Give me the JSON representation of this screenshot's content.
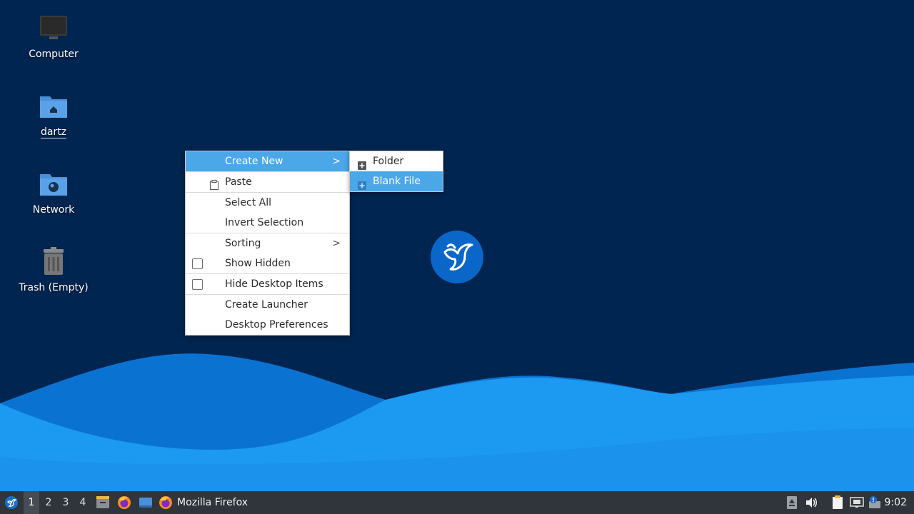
{
  "desktop": {
    "icons": [
      {
        "label": "Computer"
      },
      {
        "label": "dartz"
      },
      {
        "label": "Network"
      },
      {
        "label": "Trash (Empty)"
      }
    ]
  },
  "context_menu": {
    "items": [
      {
        "label": "Create New",
        "has_submenu": true,
        "highlighted": true
      },
      {
        "label": "Paste"
      },
      {
        "label": "Select All"
      },
      {
        "label": "Invert Selection"
      },
      {
        "label": "Sorting",
        "has_submenu": true
      },
      {
        "label": "Show Hidden",
        "checked": false
      },
      {
        "label": "Hide Desktop Items",
        "checked": false
      },
      {
        "label": "Create Launcher"
      },
      {
        "label": "Desktop Preferences"
      }
    ],
    "submenu_arrow": ">"
  },
  "submenu": {
    "items": [
      {
        "label": "Folder"
      },
      {
        "label": "Blank File",
        "highlighted": true
      }
    ]
  },
  "taskbar": {
    "workspaces": [
      "1",
      "2",
      "3",
      "4"
    ],
    "current_workspace": "1",
    "window_title": "Mozilla Firefox",
    "clock": "9:02"
  },
  "colors": {
    "background": "#002550",
    "wave_light": "#1c9af2",
    "highlight": "#4aa7e8",
    "panel": "#2f353b"
  },
  "icons": {
    "start": "lubuntu-logo-icon",
    "files": "file-manager-icon",
    "browser": "firefox-icon",
    "desktop": "show-desktop-icon",
    "tray": [
      "eject-icon",
      "volume-icon",
      "clipboard-icon",
      "network-icon",
      "update-notifier-icon"
    ]
  }
}
